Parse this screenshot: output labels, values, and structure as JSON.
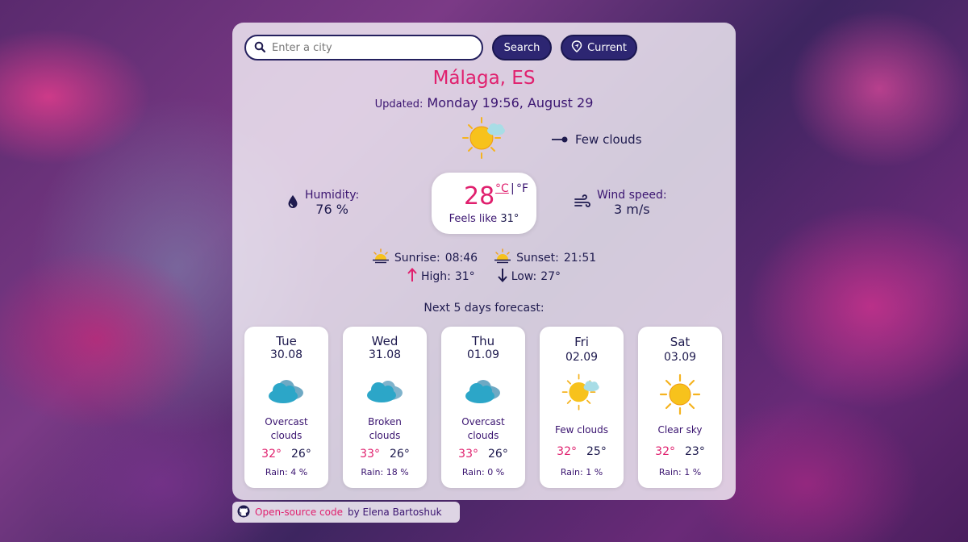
{
  "search": {
    "placeholder": "Enter a city",
    "search_label": "Search",
    "current_label": "Current"
  },
  "location": {
    "city": "Málaga, ES"
  },
  "updated": {
    "label": "Updated:",
    "value": "Monday 19:56, August 29"
  },
  "current": {
    "icon": "few-clouds-icon",
    "description": "Few clouds",
    "temperature": "28",
    "unit_c": "°C",
    "unit_sep": "|",
    "unit_f": "°F",
    "feels_label": "Feels like",
    "feels_value": "31°",
    "humidity_label": "Humidity:",
    "humidity_value": "76 %",
    "wind_label": "Wind speed:",
    "wind_value": "3 m/s",
    "sunrise_label": "Sunrise:",
    "sunrise_value": "08:46",
    "sunset_label": "Sunset:",
    "sunset_value": "21:51",
    "high_label": "High:",
    "high_value": "31°",
    "low_label": "Low:",
    "low_value": "27°"
  },
  "forecast": {
    "title": "Next 5 days forecast:",
    "days": [
      {
        "day": "Tue",
        "date": "30.08",
        "icon": "overcast-clouds-icon",
        "desc1": "Overcast",
        "desc2": "clouds",
        "high": "32°",
        "low": "26°",
        "rain_label": "Rain:",
        "rain": "4 %"
      },
      {
        "day": "Wed",
        "date": "31.08",
        "icon": "broken-clouds-icon",
        "desc1": "Broken",
        "desc2": "clouds",
        "high": "33°",
        "low": "26°",
        "rain_label": "Rain:",
        "rain": "18 %"
      },
      {
        "day": "Thu",
        "date": "01.09",
        "icon": "overcast-clouds-icon",
        "desc1": "Overcast",
        "desc2": "clouds",
        "high": "33°",
        "low": "26°",
        "rain_label": "Rain:",
        "rain": "0 %"
      },
      {
        "day": "Fri",
        "date": "02.09",
        "icon": "few-clouds-icon",
        "desc1": "Few clouds",
        "desc2": "",
        "high": "32°",
        "low": "25°",
        "rain_label": "Rain:",
        "rain": "1 %"
      },
      {
        "day": "Sat",
        "date": "03.09",
        "icon": "clear-sky-icon",
        "desc1": "Clear sky",
        "desc2": "",
        "high": "32°",
        "low": "23°",
        "rain_label": "Rain:",
        "rain": "1 %"
      }
    ]
  },
  "footer": {
    "link_text": "Open-source code",
    "by_text": "by Elena Bartoshuk"
  },
  "colors": {
    "accent": "#e0206e",
    "primary": "#2d2672",
    "text": "#1e1a4e"
  }
}
